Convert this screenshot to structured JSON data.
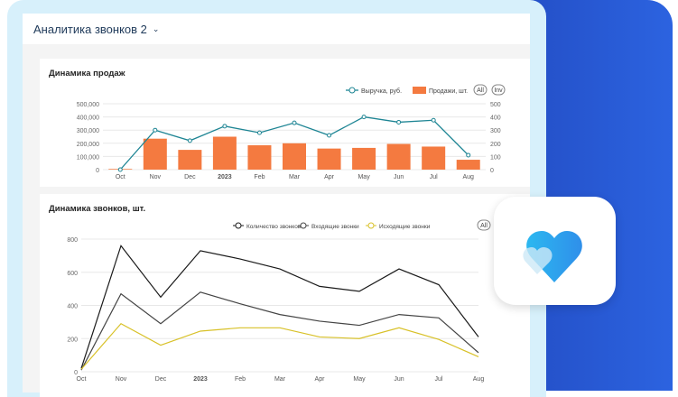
{
  "header": {
    "title": "Аналитика звонков 2"
  },
  "colors": {
    "revenue": "#1e8594",
    "sales": "#f47a40",
    "total": "#1a1a1a",
    "incoming": "#444444",
    "outgoing": "#d8c128",
    "brand": "#2c63e0"
  },
  "icon_tile": {
    "icon": "hearts-icon"
  },
  "chart_data": [
    {
      "type": "bar",
      "title": "Динамика продаж",
      "categories": [
        "Oct",
        "Nov",
        "Dec",
        "2023",
        "Feb",
        "Mar",
        "Apr",
        "May",
        "Jun",
        "Jul",
        "Aug"
      ],
      "series": [
        {
          "name": "Выручка, руб.",
          "type": "line",
          "axis": "left",
          "values": [
            0,
            300000,
            220000,
            330000,
            280000,
            355000,
            260000,
            400000,
            360000,
            375000,
            110000
          ]
        },
        {
          "name": "Продажи, шт.",
          "type": "bar",
          "axis": "right",
          "values": [
            5,
            235,
            150,
            250,
            185,
            200,
            160,
            165,
            195,
            175,
            75
          ]
        }
      ],
      "left_ticks": [
        "0",
        "100,000",
        "200,000",
        "300,000",
        "400,000",
        "500,000"
      ],
      "right_ticks": [
        "0",
        "100",
        "200",
        "300",
        "400",
        "500"
      ],
      "ylim_left": [
        0,
        500000
      ],
      "ylim_right": [
        0,
        500
      ],
      "legend_buttons": [
        "All",
        "Inv"
      ],
      "legend": "top-right",
      "grid": true
    },
    {
      "type": "line",
      "title": "Динамика звонков, шт.",
      "categories": [
        "Oct",
        "Nov",
        "Dec",
        "2023",
        "Feb",
        "Mar",
        "Apr",
        "May",
        "Jun",
        "Jul",
        "Aug"
      ],
      "series": [
        {
          "name": "Количество звонков",
          "values": [
            20,
            760,
            450,
            730,
            680,
            620,
            515,
            485,
            620,
            525,
            210
          ]
        },
        {
          "name": "Входящие звонки",
          "values": [
            10,
            470,
            290,
            480,
            410,
            345,
            305,
            280,
            345,
            325,
            115
          ]
        },
        {
          "name": "Исходящие звонки",
          "values": [
            15,
            290,
            160,
            245,
            265,
            265,
            210,
            200,
            265,
            195,
            90
          ]
        }
      ],
      "y_ticks": [
        "0",
        "200",
        "400",
        "600",
        "800"
      ],
      "ylim": [
        0,
        800
      ],
      "legend_buttons": [
        "All"
      ],
      "legend": "top-right",
      "grid": true
    }
  ]
}
